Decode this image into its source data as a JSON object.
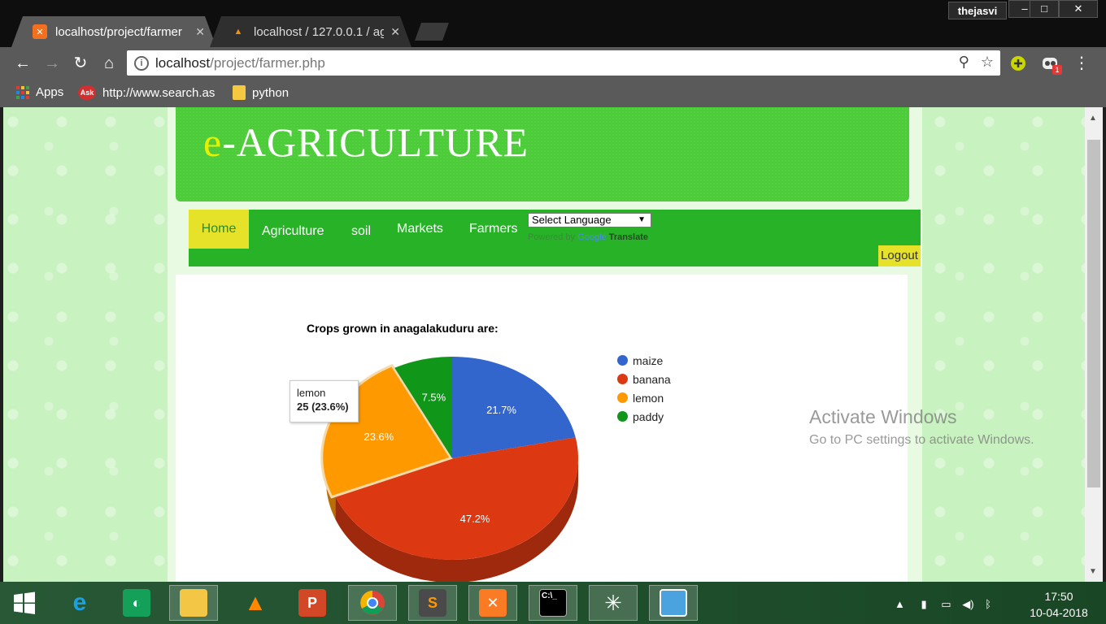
{
  "browser": {
    "user": "thejasvi",
    "tabs": [
      {
        "title": "localhost/project/farmer",
        "favicon": "xampp-icon",
        "active": true
      },
      {
        "title": "localhost / 127.0.0.1 / ag",
        "favicon": "phpmyadmin-icon",
        "active": false
      }
    ],
    "url_host": "localhost",
    "url_path": "/project/farmer.php",
    "bookmarks": [
      {
        "label": "Apps",
        "icon": "apps-grid-icon"
      },
      {
        "label": "http://www.search.as",
        "icon": "ask-icon"
      },
      {
        "label": "python",
        "icon": "folder-icon"
      }
    ],
    "extension_badge": "1"
  },
  "site": {
    "logo_e": "e",
    "logo_rest": "-AGRICULTURE",
    "nav": [
      {
        "label": "Home",
        "active": true
      },
      {
        "label": "Agriculture"
      },
      {
        "label": "soil"
      },
      {
        "label": "Markets"
      },
      {
        "label": "Farmers"
      }
    ],
    "language_select": "Select Language",
    "powered_by": "Powered by",
    "google": "Google",
    "translate": "Translate",
    "logout": "Logout"
  },
  "chart_data": {
    "type": "pie",
    "title": "Crops grown in anagalakuduru are:",
    "categories": [
      "maize",
      "banana",
      "lemon",
      "paddy"
    ],
    "values": [
      23,
      50,
      25,
      8
    ],
    "percent_labels": [
      "21.7%",
      "47.2%",
      "23.6%",
      "7.5%"
    ],
    "colors": [
      "#3366cc",
      "#dc3912",
      "#ff9900",
      "#109618"
    ],
    "legend_position": "right",
    "is3D": true,
    "tooltip": {
      "label": "lemon",
      "value": "25 (23.6%)"
    }
  },
  "watermark": {
    "title": "Activate Windows",
    "subtitle": "Go to PC settings to activate Windows."
  },
  "taskbar": {
    "time": "17:50",
    "date": "10-04-2018",
    "apps": [
      "windows-start-icon",
      "internet-explorer-icon",
      "app-icon",
      "file-explorer-icon",
      "vlc-icon",
      "powerpoint-icon",
      "chrome-icon",
      "sublime-text-icon",
      "xampp-icon",
      "command-prompt-icon",
      "spider-icon",
      "photos-icon"
    ]
  }
}
